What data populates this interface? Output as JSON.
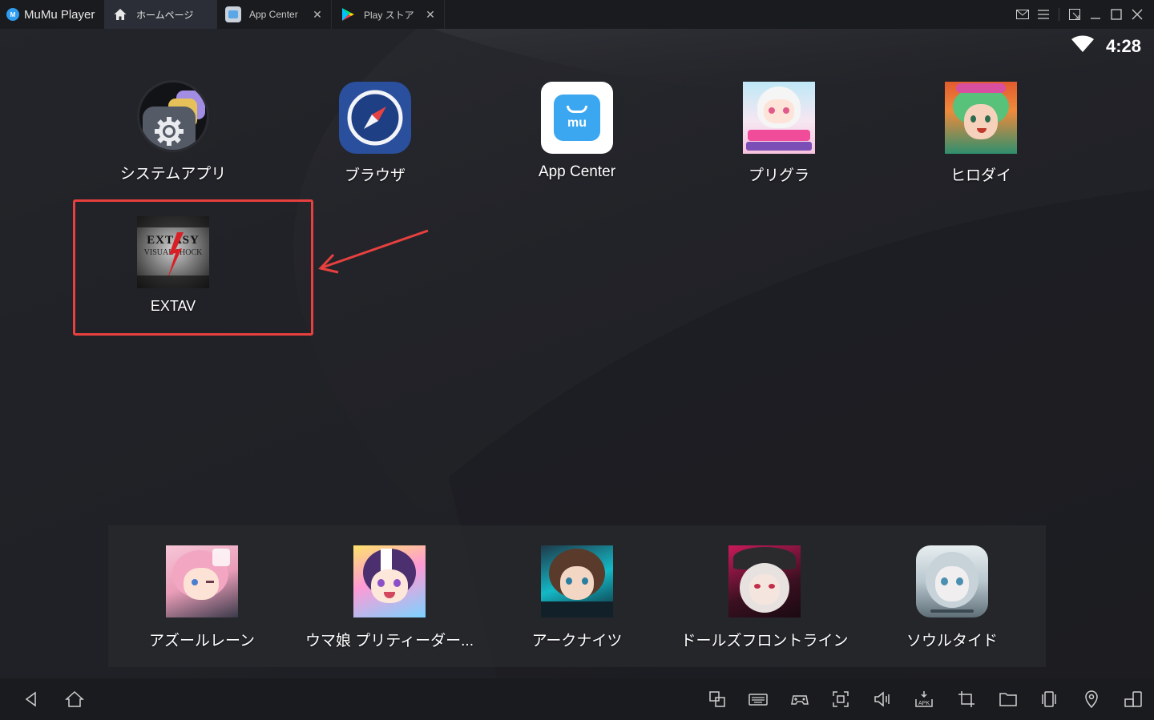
{
  "window": {
    "app_name": "MuMu Player",
    "logo_text": "M"
  },
  "tabs": [
    {
      "label": "ホームページ",
      "active": true,
      "icon": "home-icon"
    },
    {
      "label": "App Center",
      "active": false,
      "icon": "app-center-icon",
      "close": "✕"
    },
    {
      "label": "Play ストア",
      "active": false,
      "icon": "play-store-icon",
      "close": "✕"
    }
  ],
  "status_bar": {
    "time": "4:28",
    "wifi_icon": "wifi-icon"
  },
  "home_apps": [
    {
      "label": "システムアプリ",
      "icon": "system-apps-folder-icon"
    },
    {
      "label": "ブラウザ",
      "icon": "browser-compass-icon"
    },
    {
      "label": "App Center",
      "icon": "app-center-icon"
    },
    {
      "label": "プリグラ",
      "icon": "priconne-grandmasters-icon"
    },
    {
      "label": "ヒロダイ",
      "icon": "hirodai-icon"
    },
    {
      "label": "EXTAV",
      "icon": "extav-icon",
      "icon_text_1": "EXTASY",
      "icon_text_2": "VISUAL SHOCK"
    }
  ],
  "dock_apps": [
    {
      "label": "アズールレーン",
      "icon": "azur-lane-icon"
    },
    {
      "label": "ウマ娘 プリティーダー...",
      "icon": "uma-musume-icon"
    },
    {
      "label": "アークナイツ",
      "icon": "arknights-icon"
    },
    {
      "label": "ドールズフロントライン",
      "icon": "girls-frontline-icon"
    },
    {
      "label": "ソウルタイド",
      "icon": "soul-tide-icon"
    }
  ],
  "annotation": {
    "highlight_color": "#e8403f",
    "target": "EXTAV"
  },
  "toolbar_icons": [
    "back-icon",
    "home-icon",
    "multi-window-icon",
    "keyboard-icon",
    "gamepad-icon",
    "screenshot-icon",
    "volume-icon",
    "apk-install-icon",
    "crop-icon",
    "folder-icon",
    "shake-icon",
    "location-icon",
    "rotate-screen-icon"
  ],
  "colors": {
    "accent": "#2e9df1",
    "highlight": "#e8403f",
    "titlebar": "#1a1b1e"
  }
}
